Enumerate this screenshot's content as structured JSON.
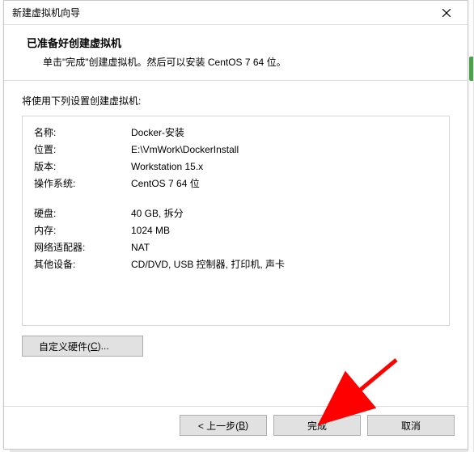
{
  "window": {
    "title": "新建虚拟机向导"
  },
  "header": {
    "heading": "已准备好创建虚拟机",
    "sub": "单击\"完成\"创建虚拟机。然后可以安装 CentOS 7 64 位。"
  },
  "body": {
    "intro": "将使用下列设置创建虚拟机:",
    "rows1": [
      {
        "k": "名称:",
        "v": "Docker-安装"
      },
      {
        "k": "位置:",
        "v": "E:\\VmWork\\DockerInstall"
      },
      {
        "k": "版本:",
        "v": "Workstation 15.x"
      },
      {
        "k": "操作系统:",
        "v": "CentOS 7 64 位"
      }
    ],
    "rows2": [
      {
        "k": "硬盘:",
        "v": "40 GB, 拆分"
      },
      {
        "k": "内存:",
        "v": "1024 MB"
      },
      {
        "k": "网络适配器:",
        "v": "NAT"
      },
      {
        "k": "其他设备:",
        "v": "CD/DVD, USB 控制器, 打印机, 声卡"
      }
    ],
    "customize_pre": "自定义硬件(",
    "customize_key": "C",
    "customize_post": ")..."
  },
  "footer": {
    "back_pre": "< 上一步(",
    "back_key": "B",
    "back_post": ")",
    "finish": "完成",
    "cancel": "取消"
  }
}
